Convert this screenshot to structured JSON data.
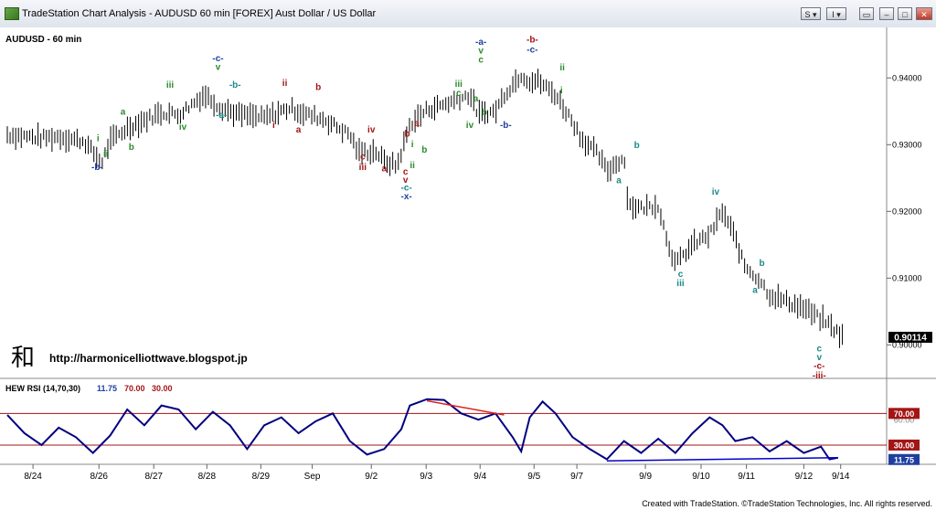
{
  "window": {
    "title": "TradeStation Chart Analysis - AUDUSD 60 min [FOREX] Aust Dollar / US Dollar",
    "buttons": [
      "S",
      "I"
    ]
  },
  "chart_data": [
    {
      "type": "bar",
      "subtype": "ohlc-price",
      "title": "AUDUSD - 60 min",
      "ylim": [
        0.8958,
        0.9462
      ],
      "yticks": [
        {
          "value": 0.94,
          "label": "0.94000"
        },
        {
          "value": 0.93,
          "label": "0.93000"
        },
        {
          "value": 0.92,
          "label": "0.92000"
        },
        {
          "value": 0.91,
          "label": "0.91000"
        },
        {
          "value": 0.9,
          "label": "0.90000"
        }
      ],
      "last_price": {
        "value": 0.90114,
        "label": "0.90114"
      },
      "x_dates": [
        "8/24",
        "8/26",
        "8/27",
        "8/28",
        "8/29",
        "Sep",
        "9/2",
        "9/3",
        "9/4",
        "9/5",
        "9/7",
        "9/9",
        "9/10",
        "9/11",
        "9/12",
        "9/14"
      ],
      "price_path": [
        [
          0,
          0.9315
        ],
        [
          0.04,
          0.931
        ],
        [
          0.06,
          0.9312
        ],
        [
          0.09,
          0.9305
        ],
        [
          0.11,
          0.9272
        ],
        [
          0.12,
          0.9305
        ],
        [
          0.14,
          0.9325
        ],
        [
          0.18,
          0.9348
        ],
        [
          0.2,
          0.9345
        ],
        [
          0.23,
          0.9375
        ],
        [
          0.25,
          0.9355
        ],
        [
          0.27,
          0.9345
        ],
        [
          0.3,
          0.934
        ],
        [
          0.33,
          0.9355
        ],
        [
          0.35,
          0.9345
        ],
        [
          0.37,
          0.9338
        ],
        [
          0.4,
          0.9315
        ],
        [
          0.41,
          0.9288
        ],
        [
          0.43,
          0.929
        ],
        [
          0.44,
          0.9275
        ],
        [
          0.455,
          0.9268
        ],
        [
          0.47,
          0.933
        ],
        [
          0.49,
          0.9352
        ],
        [
          0.52,
          0.9365
        ],
        [
          0.54,
          0.9375
        ],
        [
          0.55,
          0.9345
        ],
        [
          0.57,
          0.935
        ],
        [
          0.58,
          0.9375
        ],
        [
          0.6,
          0.9405
        ],
        [
          0.61,
          0.9395
        ],
        [
          0.62,
          0.9395
        ],
        [
          0.64,
          0.9375
        ],
        [
          0.66,
          0.9335
        ],
        [
          0.67,
          0.931
        ],
        [
          0.69,
          0.9285
        ],
        [
          0.7,
          0.926
        ],
        [
          0.72,
          0.9282
        ],
        [
          0.725,
          0.921
        ],
        [
          0.74,
          0.9205
        ],
        [
          0.76,
          0.921
        ],
        [
          0.77,
          0.916
        ],
        [
          0.78,
          0.912
        ],
        [
          0.8,
          0.915
        ],
        [
          0.82,
          0.9165
        ],
        [
          0.835,
          0.92
        ],
        [
          0.85,
          0.916
        ],
        [
          0.86,
          0.912
        ],
        [
          0.88,
          0.9095
        ],
        [
          0.89,
          0.9075
        ],
        [
          0.91,
          0.9065
        ],
        [
          0.93,
          0.9055
        ],
        [
          0.945,
          0.9042
        ],
        [
          0.955,
          0.9035
        ],
        [
          0.96,
          0.903
        ],
        [
          0.975,
          0.9012
        ]
      ],
      "wave_labels": [
        {
          "text": "-b-",
          "color": "#1f3fa0",
          "at": [
            0.105,
            0.9262
          ]
        },
        {
          "text": "i",
          "color": "#2d8a2d",
          "at": [
            0.106,
            0.9305
          ]
        },
        {
          "text": "ii",
          "color": "#2d8a2d",
          "at": [
            0.115,
            0.9282
          ]
        },
        {
          "text": "a",
          "color": "#2d8a2d",
          "at": [
            0.135,
            0.9345
          ]
        },
        {
          "text": "b",
          "color": "#2d8a2d",
          "at": [
            0.145,
            0.9292
          ]
        },
        {
          "text": "iii",
          "color": "#2d8a2d",
          "at": [
            0.19,
            0.9385
          ]
        },
        {
          "text": "iv",
          "color": "#2d8a2d",
          "at": [
            0.205,
            0.9322
          ]
        },
        {
          "text": "-c-",
          "color": "#1f3fa0",
          "at": [
            0.246,
            0.9425
          ]
        },
        {
          "text": "v",
          "color": "#2d8a2d",
          "at": [
            0.246,
            0.9412
          ]
        },
        {
          "text": "-b-",
          "color": "#1a8a8a",
          "at": [
            0.266,
            0.9385
          ]
        },
        {
          "text": "-a-",
          "color": "#1a8a8a",
          "at": [
            0.25,
            0.934
          ]
        },
        {
          "text": "ii",
          "color": "#a31515",
          "at": [
            0.324,
            0.9388
          ]
        },
        {
          "text": "i",
          "color": "#a31515",
          "at": [
            0.311,
            0.9325
          ]
        },
        {
          "text": "a",
          "color": "#a31515",
          "at": [
            0.34,
            0.9318
          ]
        },
        {
          "text": "b",
          "color": "#a31515",
          "at": [
            0.363,
            0.9382
          ]
        },
        {
          "text": "iv",
          "color": "#a31515",
          "at": [
            0.425,
            0.9318
          ]
        },
        {
          "text": "c",
          "color": "#a31515",
          "at": [
            0.415,
            0.9278
          ]
        },
        {
          "text": "iii",
          "color": "#a31515",
          "at": [
            0.415,
            0.9262
          ]
        },
        {
          "text": "a",
          "color": "#a31515",
          "at": [
            0.44,
            0.926
          ]
        },
        {
          "text": "b",
          "color": "#a31515",
          "at": [
            0.467,
            0.9312
          ]
        },
        {
          "text": "a",
          "color": "#a31515",
          "at": [
            0.478,
            0.9328
          ]
        },
        {
          "text": "i",
          "color": "#2d8a2d",
          "at": [
            0.473,
            0.9296
          ]
        },
        {
          "text": "b",
          "color": "#2d8a2d",
          "at": [
            0.487,
            0.9288
          ]
        },
        {
          "text": "ii",
          "color": "#2d8a2d",
          "at": [
            0.473,
            0.9265
          ]
        },
        {
          "text": "c",
          "color": "#a31515",
          "at": [
            0.465,
            0.9255
          ]
        },
        {
          "text": "v",
          "color": "#a31515",
          "at": [
            0.465,
            0.9243
          ]
        },
        {
          "text": "-c-",
          "color": "#1a8a8a",
          "at": [
            0.466,
            0.9231
          ]
        },
        {
          "text": "-x-",
          "color": "#1f3fa0",
          "at": [
            0.466,
            0.9218
          ]
        },
        {
          "text": "iii",
          "color": "#2d8a2d",
          "at": [
            0.527,
            0.9387
          ]
        },
        {
          "text": "c",
          "color": "#2d8a2d",
          "at": [
            0.527,
            0.9373
          ]
        },
        {
          "text": "iv",
          "color": "#2d8a2d",
          "at": [
            0.54,
            0.9325
          ]
        },
        {
          "text": "-a-",
          "color": "#1f3fa0",
          "at": [
            0.553,
            0.945
          ]
        },
        {
          "text": "v",
          "color": "#2d8a2d",
          "at": [
            0.553,
            0.9437
          ]
        },
        {
          "text": "c",
          "color": "#2d8a2d",
          "at": [
            0.553,
            0.9423
          ]
        },
        {
          "text": "a",
          "color": "#2d8a2d",
          "at": [
            0.547,
            0.9365
          ]
        },
        {
          "text": "b",
          "color": "#2d8a2d",
          "at": [
            0.557,
            0.9344
          ]
        },
        {
          "text": "-b-",
          "color": "#1f3fa0",
          "at": [
            0.582,
            0.9325
          ]
        },
        {
          "text": "-b-",
          "color": "#a31515",
          "at": [
            0.613,
            0.9453
          ]
        },
        {
          "text": "-c-",
          "color": "#1f3fa0",
          "at": [
            0.613,
            0.9438
          ]
        },
        {
          "text": "ii",
          "color": "#2d8a2d",
          "at": [
            0.648,
            0.9411
          ]
        },
        {
          "text": "i",
          "color": "#2d8a2d",
          "at": [
            0.647,
            0.9377
          ]
        },
        {
          "text": "b",
          "color": "#1a8a8a",
          "at": [
            0.735,
            0.9295
          ]
        },
        {
          "text": "a",
          "color": "#1a8a8a",
          "at": [
            0.714,
            0.9242
          ]
        },
        {
          "text": "c",
          "color": "#1a8a8a",
          "at": [
            0.786,
            0.9102
          ]
        },
        {
          "text": "iii",
          "color": "#1a8a8a",
          "at": [
            0.786,
            0.9088
          ]
        },
        {
          "text": "iv",
          "color": "#1a8a8a",
          "at": [
            0.827,
            0.9225
          ]
        },
        {
          "text": "b",
          "color": "#1a8a8a",
          "at": [
            0.881,
            0.9118
          ]
        },
        {
          "text": "a",
          "color": "#1a8a8a",
          "at": [
            0.873,
            0.9078
          ]
        },
        {
          "text": "c",
          "color": "#1a8a8a",
          "at": [
            0.948,
            0.899
          ]
        },
        {
          "text": "v",
          "color": "#1a8a8a",
          "at": [
            0.948,
            0.8977
          ]
        },
        {
          "text": "-c-",
          "color": "#a31515",
          "at": [
            0.948,
            0.8964
          ]
        },
        {
          "text": "-iii-",
          "color": "#a31515",
          "at": [
            0.948,
            0.895
          ]
        }
      ],
      "watermark": {
        "logo_char": "和",
        "url": "http://harmonicelliottwave.blogspot.jp"
      }
    },
    {
      "type": "line",
      "subtype": "indicator",
      "title": "HEW RSI (14,70,30)",
      "legend": [
        {
          "text": "11.75",
          "color": "#1f3fa0"
        },
        {
          "text": "70.00",
          "color": "#a31515"
        },
        {
          "text": "30.00",
          "color": "#a31515"
        }
      ],
      "ylim": [
        8,
        90
      ],
      "levels": [
        {
          "value": 70,
          "label": "70.00",
          "color": "#a31515"
        },
        {
          "value": 30,
          "label": "30.00",
          "color": "#a31515"
        }
      ],
      "ytick_overlap_label": "60.00",
      "last_value": {
        "value": 11.75,
        "label": "11.75"
      },
      "series": [
        {
          "color": "#000080",
          "points": [
            [
              0,
              68
            ],
            [
              0.02,
              45
            ],
            [
              0.04,
              30
            ],
            [
              0.06,
              52
            ],
            [
              0.08,
              40
            ],
            [
              0.1,
              20
            ],
            [
              0.12,
              42
            ],
            [
              0.14,
              75
            ],
            [
              0.16,
              55
            ],
            [
              0.18,
              80
            ],
            [
              0.2,
              75
            ],
            [
              0.22,
              50
            ],
            [
              0.24,
              72
            ],
            [
              0.26,
              55
            ],
            [
              0.28,
              25
            ],
            [
              0.3,
              55
            ],
            [
              0.32,
              65
            ],
            [
              0.34,
              45
            ],
            [
              0.36,
              60
            ],
            [
              0.38,
              70
            ],
            [
              0.4,
              35
            ],
            [
              0.42,
              18
            ],
            [
              0.44,
              25
            ],
            [
              0.46,
              50
            ],
            [
              0.47,
              80
            ],
            [
              0.49,
              88
            ],
            [
              0.51,
              87
            ],
            [
              0.53,
              70
            ],
            [
              0.55,
              62
            ],
            [
              0.57,
              70
            ],
            [
              0.59,
              40
            ],
            [
              0.6,
              22
            ],
            [
              0.61,
              65
            ],
            [
              0.625,
              85
            ],
            [
              0.64,
              70
            ],
            [
              0.66,
              40
            ],
            [
              0.68,
              25
            ],
            [
              0.7,
              12
            ],
            [
              0.72,
              35
            ],
            [
              0.74,
              20
            ],
            [
              0.76,
              38
            ],
            [
              0.78,
              20
            ],
            [
              0.8,
              45
            ],
            [
              0.82,
              65
            ],
            [
              0.835,
              55
            ],
            [
              0.85,
              35
            ],
            [
              0.87,
              40
            ],
            [
              0.89,
              22
            ],
            [
              0.91,
              35
            ],
            [
              0.93,
              20
            ],
            [
              0.95,
              28
            ],
            [
              0.96,
              12
            ],
            [
              0.97,
              14
            ]
          ]
        }
      ],
      "trendlines": [
        {
          "color": "#e02020",
          "from": [
            0.49,
            86
          ],
          "to": [
            0.58,
            68
          ]
        },
        {
          "color": "#0000cc",
          "from": [
            0.7,
            10
          ],
          "to": [
            0.97,
            14
          ]
        }
      ]
    }
  ],
  "footer": {
    "text": "Created with TradeStation. ©TradeStation Technologies, Inc. All rights reserved."
  }
}
